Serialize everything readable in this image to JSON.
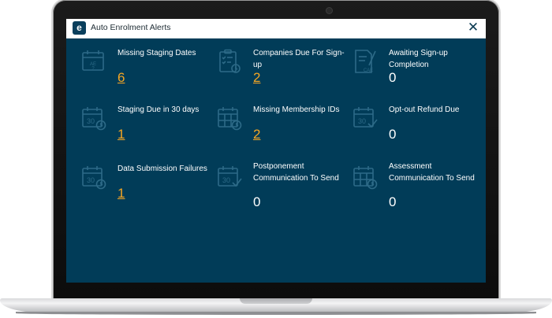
{
  "window": {
    "title": "Auto Enrolment Alerts",
    "logo": "e",
    "close_glyph": "✕"
  },
  "colors": {
    "screen_bg": "#013c58",
    "count_link": "#f5a623",
    "icon": "#2d6a87"
  },
  "alerts": [
    {
      "label": "Missing Staging Dates",
      "count": "6",
      "icon": "calendar-ae-question-icon",
      "link": true
    },
    {
      "label": "Companies Due For Sign-up",
      "count": "2",
      "icon": "clipboard-checklist-clock-icon",
      "link": true
    },
    {
      "label": "Awaiting Sign-up Completion",
      "count": "0",
      "icon": "document-pen-cae-icon",
      "link": false
    },
    {
      "label": "Staging Due in 30 days",
      "count": "1",
      "icon": "calendar-30-clock-icon",
      "link": true
    },
    {
      "label": "Missing Membership IDs",
      "count": "2",
      "icon": "calendar-grid-clock-icon",
      "link": true
    },
    {
      "label": "Opt-out Refund Due",
      "count": "0",
      "icon": "calendar-30-check-icon",
      "link": false
    },
    {
      "label": "Data Submission Failures",
      "count": "1",
      "icon": "calendar-30-clock-icon",
      "link": true
    },
    {
      "label": "Postponement Communication To Send",
      "count": "0",
      "icon": "calendar-30-check-icon",
      "link": false
    },
    {
      "label": "Assessment Communication To Send",
      "count": "0",
      "icon": "calendar-grid-clock-icon",
      "link": false
    }
  ]
}
